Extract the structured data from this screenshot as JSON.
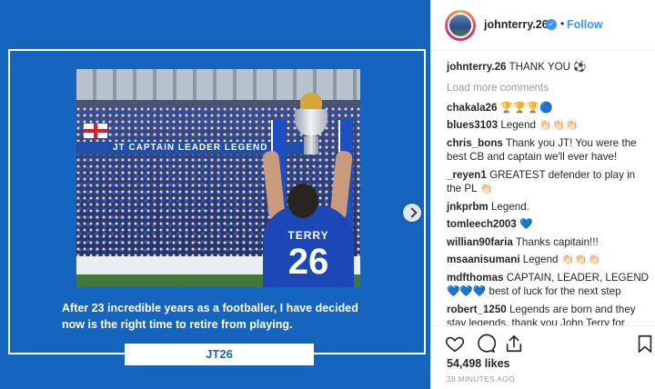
{
  "post": {
    "caption": "After 23 incredible years as a footballer, I have decided now is the right time to retire from playing.",
    "tag": "JT26",
    "photo": {
      "banner_text": "JT CAPTAIN LEADER LEGEND",
      "shirt_name": "TERRY",
      "shirt_number": "26"
    }
  },
  "header": {
    "username": "johnterry.26",
    "verified_symbol": "✓",
    "separator": "•",
    "follow_label": "Follow"
  },
  "owner_comment": {
    "user": "johnterry.26",
    "text": "THANK YOU ⚽"
  },
  "load_more_label": "Load more comments",
  "comments": [
    {
      "user": "chakala26",
      "text": "🏆🏆🏆🔵"
    },
    {
      "user": "blues3103",
      "text": "Legend 👏🏻👏🏻👏🏻"
    },
    {
      "user": "chris_bons",
      "text": "Thank you JT! You were the best CB and captain we'll ever have!"
    },
    {
      "user": "_reyen1",
      "text": "GREATEST defender to play in the PL 👏🏻"
    },
    {
      "user": "jnkprbm",
      "text": "Legend."
    },
    {
      "user": "tomleech2003",
      "text": "💙"
    },
    {
      "user": "willian90faria",
      "text": "Thanks capitain!!!"
    },
    {
      "user": "msaanisumani",
      "text": "Legend 👏🏻👏🏻👏🏻"
    },
    {
      "user": "mdfthomas",
      "text": "CAPTAIN, LEADER, LEGEND 💙💙💙 best of luck for the next step"
    },
    {
      "user": "robert_1250",
      "text": "Legends are born and they stay legends, thank you John Terry for everything you've done for us"
    }
  ],
  "footer": {
    "likes": "54,498 likes",
    "time": "28 MINUTES AGO",
    "icons": [
      "heart-icon",
      "comment-icon",
      "share-icon",
      "bookmark-icon"
    ]
  },
  "colors": {
    "media_bg": "#1565bf",
    "link_blue": "#3897f0",
    "muted": "#999999",
    "text": "#262626"
  }
}
